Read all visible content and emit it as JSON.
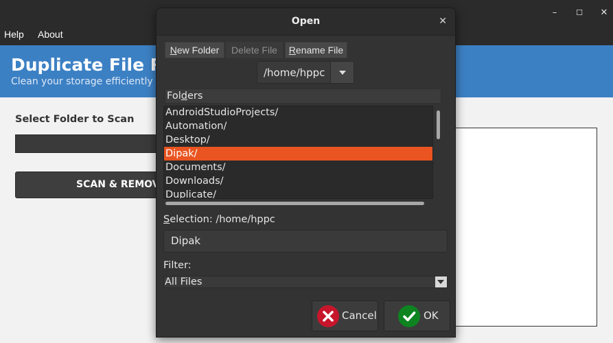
{
  "app": {
    "window_controls": {
      "minimize": "–",
      "maximize": "☐",
      "close": "✕"
    },
    "menu": [
      "Help",
      "About"
    ],
    "banner": {
      "title": "Duplicate File Re",
      "subtitle": "Clean your storage efficiently"
    },
    "select_label": "Select Folder to Scan",
    "scan_button": "SCAN & REMOV"
  },
  "dialog": {
    "title": "Open",
    "close_glyph": "✕",
    "toolbar": {
      "new_folder": {
        "u": "N",
        "rest": "ew Folder"
      },
      "delete_file": {
        "u": "D",
        "rest": "elete File"
      },
      "rename_file": {
        "u": "R",
        "rest": "ename File"
      }
    },
    "path": "/home/hppc",
    "folders_header": {
      "pre": "Fol",
      "u": "d",
      "post": "ers"
    },
    "folders": [
      "AndroidStudioProjects/",
      "Automation/",
      "Desktop/",
      "Dipak/",
      "Documents/",
      "Downloads/",
      "Duplicate/"
    ],
    "selected_folder": "Dipak/",
    "selection_label": {
      "u": "S",
      "rest": "election: /home/hppc"
    },
    "selection_value": "Dipak",
    "filter_label": "Filter:",
    "filter_value": "All Files",
    "cancel_label": "Cancel",
    "ok_label": "OK"
  },
  "colors": {
    "accent": "#e95420",
    "banner": "#3c80c4",
    "cancel_icon": "#c7162b",
    "ok_icon": "#0e8420"
  },
  "icons": {
    "cancel": "x-circle-icon",
    "ok": "check-circle-icon",
    "dropdown": "chevron-down-icon"
  }
}
